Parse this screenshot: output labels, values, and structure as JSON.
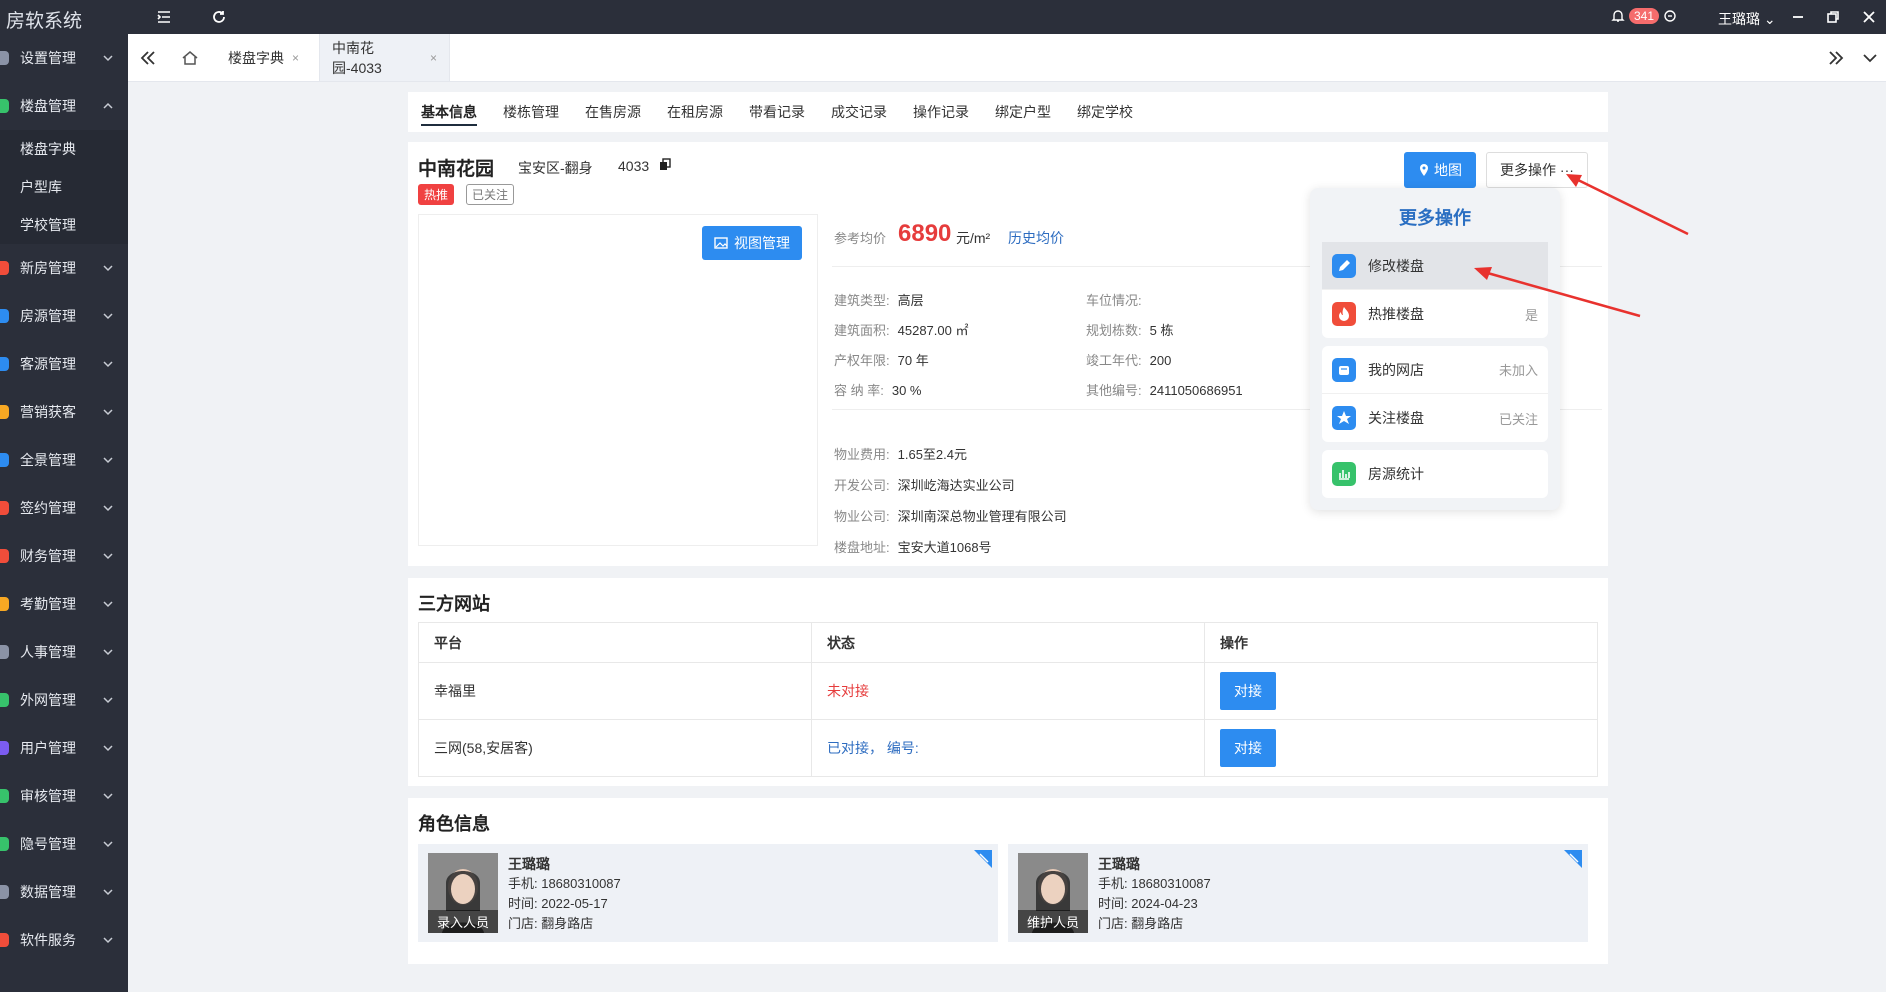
{
  "app": {
    "title": "房软系统"
  },
  "topbar": {
    "notification_count": "341",
    "user_name": "王璐璐"
  },
  "sidebar": {
    "items": [
      {
        "label": "设置管理",
        "color": "#8b93a6"
      },
      {
        "label": "楼盘管理",
        "color": "#37c26b"
      },
      {
        "label": "新房管理",
        "color": "#f04d3a"
      },
      {
        "label": "房源管理",
        "color": "#2d8cf0"
      },
      {
        "label": "客源管理",
        "color": "#2d8cf0"
      },
      {
        "label": "营销获客",
        "color": "#f7a823"
      },
      {
        "label": "全景管理",
        "color": "#2d8cf0"
      },
      {
        "label": "签约管理",
        "color": "#f04d3a"
      },
      {
        "label": "财务管理",
        "color": "#f04d3a"
      },
      {
        "label": "考勤管理",
        "color": "#f7a823"
      },
      {
        "label": "人事管理",
        "color": "#8b93a6"
      },
      {
        "label": "外网管理",
        "color": "#37c26b"
      },
      {
        "label": "用户管理",
        "color": "#7b5cf0"
      },
      {
        "label": "审核管理",
        "color": "#37c26b"
      },
      {
        "label": "隐号管理",
        "color": "#37c26b"
      },
      {
        "label": "数据管理",
        "color": "#8b93a6"
      },
      {
        "label": "软件服务",
        "color": "#f04d3a"
      }
    ],
    "sub_items": [
      "楼盘字典",
      "户型库",
      "学校管理"
    ]
  },
  "tabs": [
    {
      "label": "楼盘字典"
    },
    {
      "label": "中南花园-4033"
    }
  ],
  "subtabs": [
    "基本信息",
    "楼栋管理",
    "在售房源",
    "在租房源",
    "带看记录",
    "成交记录",
    "操作记录",
    "绑定户型",
    "绑定学校"
  ],
  "property": {
    "name": "中南花园",
    "district": "宝安区-翻身",
    "code": "4033",
    "tag_hot": "热推",
    "tag_follow": "已关注",
    "view_button": "视图管理",
    "price_label": "参考均价",
    "price": "6890",
    "price_unit": "元/m²",
    "price_history": "历史均价",
    "fields_left": [
      {
        "label": "建筑类型:",
        "value": "高层"
      },
      {
        "label": "建筑面积:",
        "value": "45287.00 ㎡"
      },
      {
        "label": "产权年限:",
        "value": "70 年"
      },
      {
        "label": "容 纳 率:",
        "value": "30 %"
      }
    ],
    "fields_right": [
      {
        "label": "车位情况:",
        "value": ""
      },
      {
        "label": "规划栋数:",
        "value": "5 栋"
      },
      {
        "label": "竣工年代:",
        "value": "200"
      },
      {
        "label": "其他编号:",
        "value": "2411050686951"
      }
    ],
    "fields_bottom": [
      {
        "label": "物业费用:",
        "value": "1.65至2.4元"
      },
      {
        "label": "开发公司:",
        "value": "深圳屹海达实业公司"
      },
      {
        "label": "物业公司:",
        "value": "深圳南深总物业管理有限公司"
      },
      {
        "label": "楼盘地址:",
        "value": "宝安大道1068号"
      }
    ]
  },
  "actions": {
    "map": "地图",
    "more": "更多操作 ···"
  },
  "dropdown": {
    "title": "更多操作",
    "group1": [
      {
        "label": "修改楼盘",
        "value": "",
        "icon": "edit-icon",
        "color": "#2d8cf0"
      },
      {
        "label": "热推楼盘",
        "value": "是",
        "icon": "fire-icon",
        "color": "#f04d3a"
      }
    ],
    "group2": [
      {
        "label": "我的网店",
        "value": "未加入",
        "icon": "shop-icon",
        "color": "#2d8cf0"
      },
      {
        "label": "关注楼盘",
        "value": "已关注",
        "icon": "star-icon",
        "color": "#2d8cf0"
      }
    ],
    "group3": [
      {
        "label": "房源统计",
        "value": "",
        "icon": "chart-icon",
        "color": "#37c26b"
      }
    ]
  },
  "third_party": {
    "title": "三方网站",
    "headers": [
      "平台",
      "状态",
      "操作"
    ],
    "rows": [
      {
        "platform": "幸福里",
        "status": "未对接",
        "action": "对接"
      },
      {
        "platform": "三网(58,安居客)",
        "status": "已对接， 编号:",
        "action": "对接"
      }
    ]
  },
  "roles": {
    "title": "角色信息",
    "people": [
      {
        "name": "王璐璐",
        "phone": "手机: 18680310087",
        "time": "时间: 2022-05-17",
        "store": "门店: 翻身路店",
        "role": "录入人员"
      },
      {
        "name": "王璐璐",
        "phone": "手机: 18680310087",
        "time": "时间: 2024-04-23",
        "store": "门店: 翻身路店",
        "role": "维护人员"
      }
    ]
  }
}
